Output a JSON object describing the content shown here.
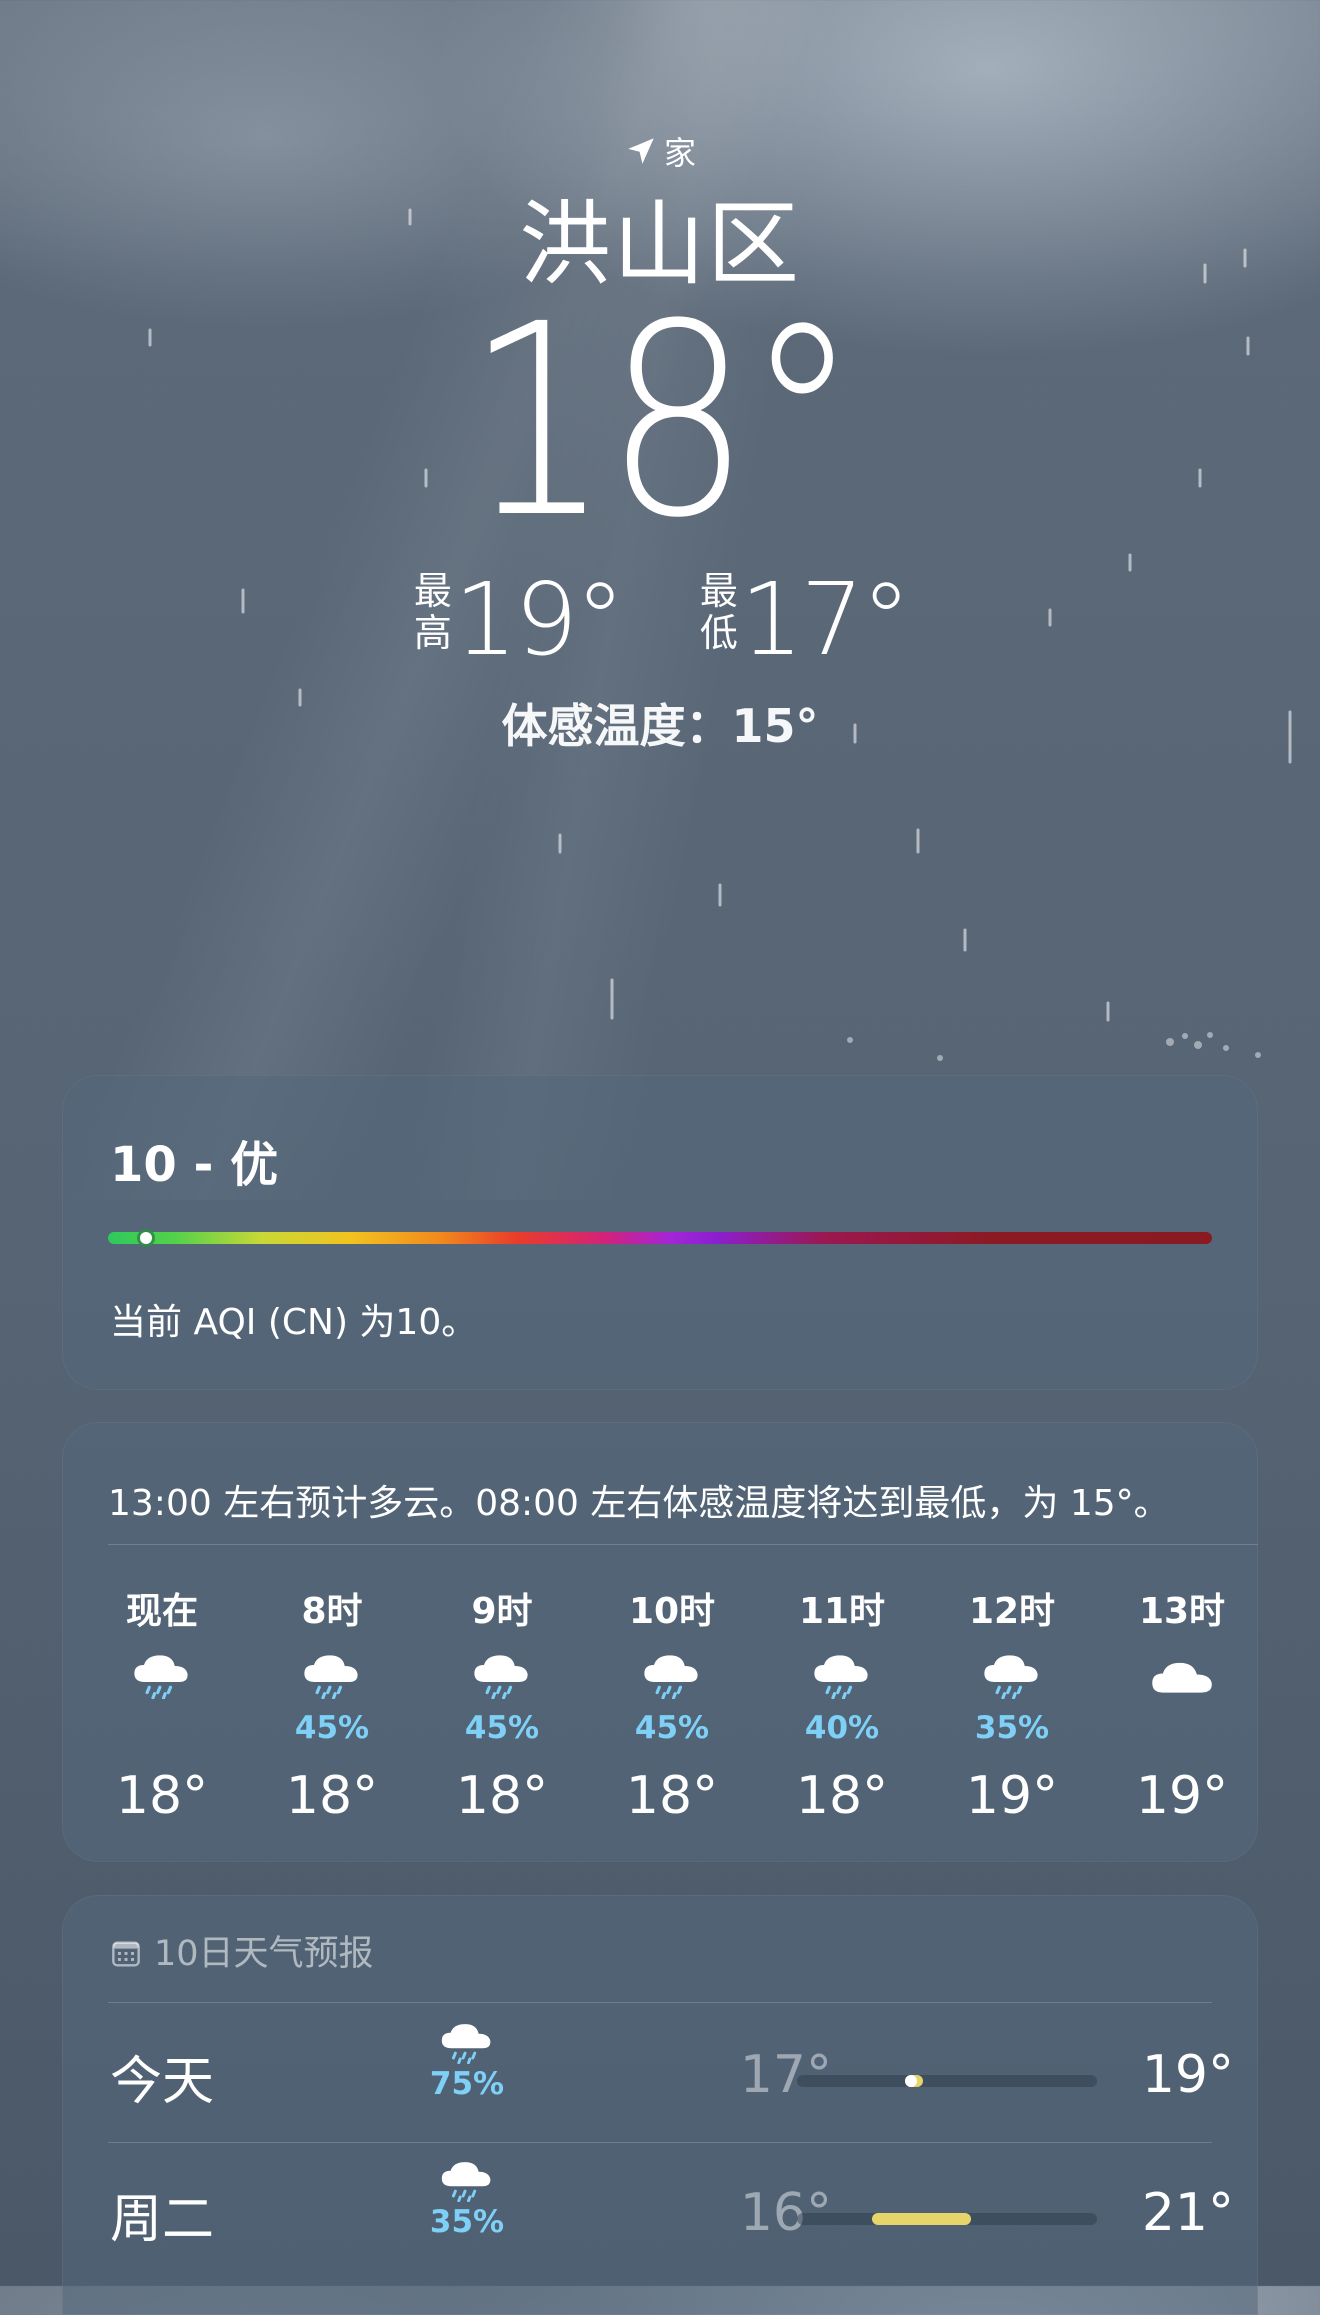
{
  "location": {
    "tag": "家",
    "icon": "location-arrow-icon",
    "city": "洪山区"
  },
  "current": {
    "temperature": "18°",
    "high_label": "最高",
    "high": "19°",
    "low_label": "最低",
    "low": "17°",
    "feels_like": "体感温度：15°"
  },
  "aqi": {
    "title": "10 - 优",
    "value": 10,
    "scale_max": 500,
    "description": "当前 AQI (CN) 为10。"
  },
  "hourly": {
    "summary": "13:00 左右预计多云。08:00 左右体感温度将达到最低，为 15°。",
    "items": [
      {
        "label": "现在",
        "icon": "rain-cloud-icon",
        "prob": "",
        "temp": "18°"
      },
      {
        "label": "8时",
        "icon": "rain-cloud-icon",
        "prob": "45%",
        "temp": "18°"
      },
      {
        "label": "9时",
        "icon": "rain-cloud-icon",
        "prob": "45%",
        "temp": "18°"
      },
      {
        "label": "10时",
        "icon": "rain-cloud-icon",
        "prob": "45%",
        "temp": "18°"
      },
      {
        "label": "11时",
        "icon": "rain-cloud-icon",
        "prob": "40%",
        "temp": "18°"
      },
      {
        "label": "12时",
        "icon": "rain-cloud-icon",
        "prob": "35%",
        "temp": "19°"
      },
      {
        "label": "13时",
        "icon": "cloud-icon",
        "prob": "",
        "temp": "19°"
      }
    ]
  },
  "daily": {
    "title": "10日天气预报",
    "icon": "calendar-icon",
    "items": [
      {
        "day": "今天",
        "icon": "rain-cloud-icon",
        "prob": "75%",
        "low": "17°",
        "high": "19°",
        "range_start": 0.36,
        "range_end": 0.42,
        "current_position": 0.36
      },
      {
        "day": "周二",
        "icon": "rain-cloud-icon",
        "prob": "35%",
        "low": "16°",
        "high": "21°",
        "range_start": 0.25,
        "range_end": 0.58
      }
    ]
  },
  "colors": {
    "accent_precip": "#7fd0f7",
    "range_bar": "#e6d56a"
  }
}
